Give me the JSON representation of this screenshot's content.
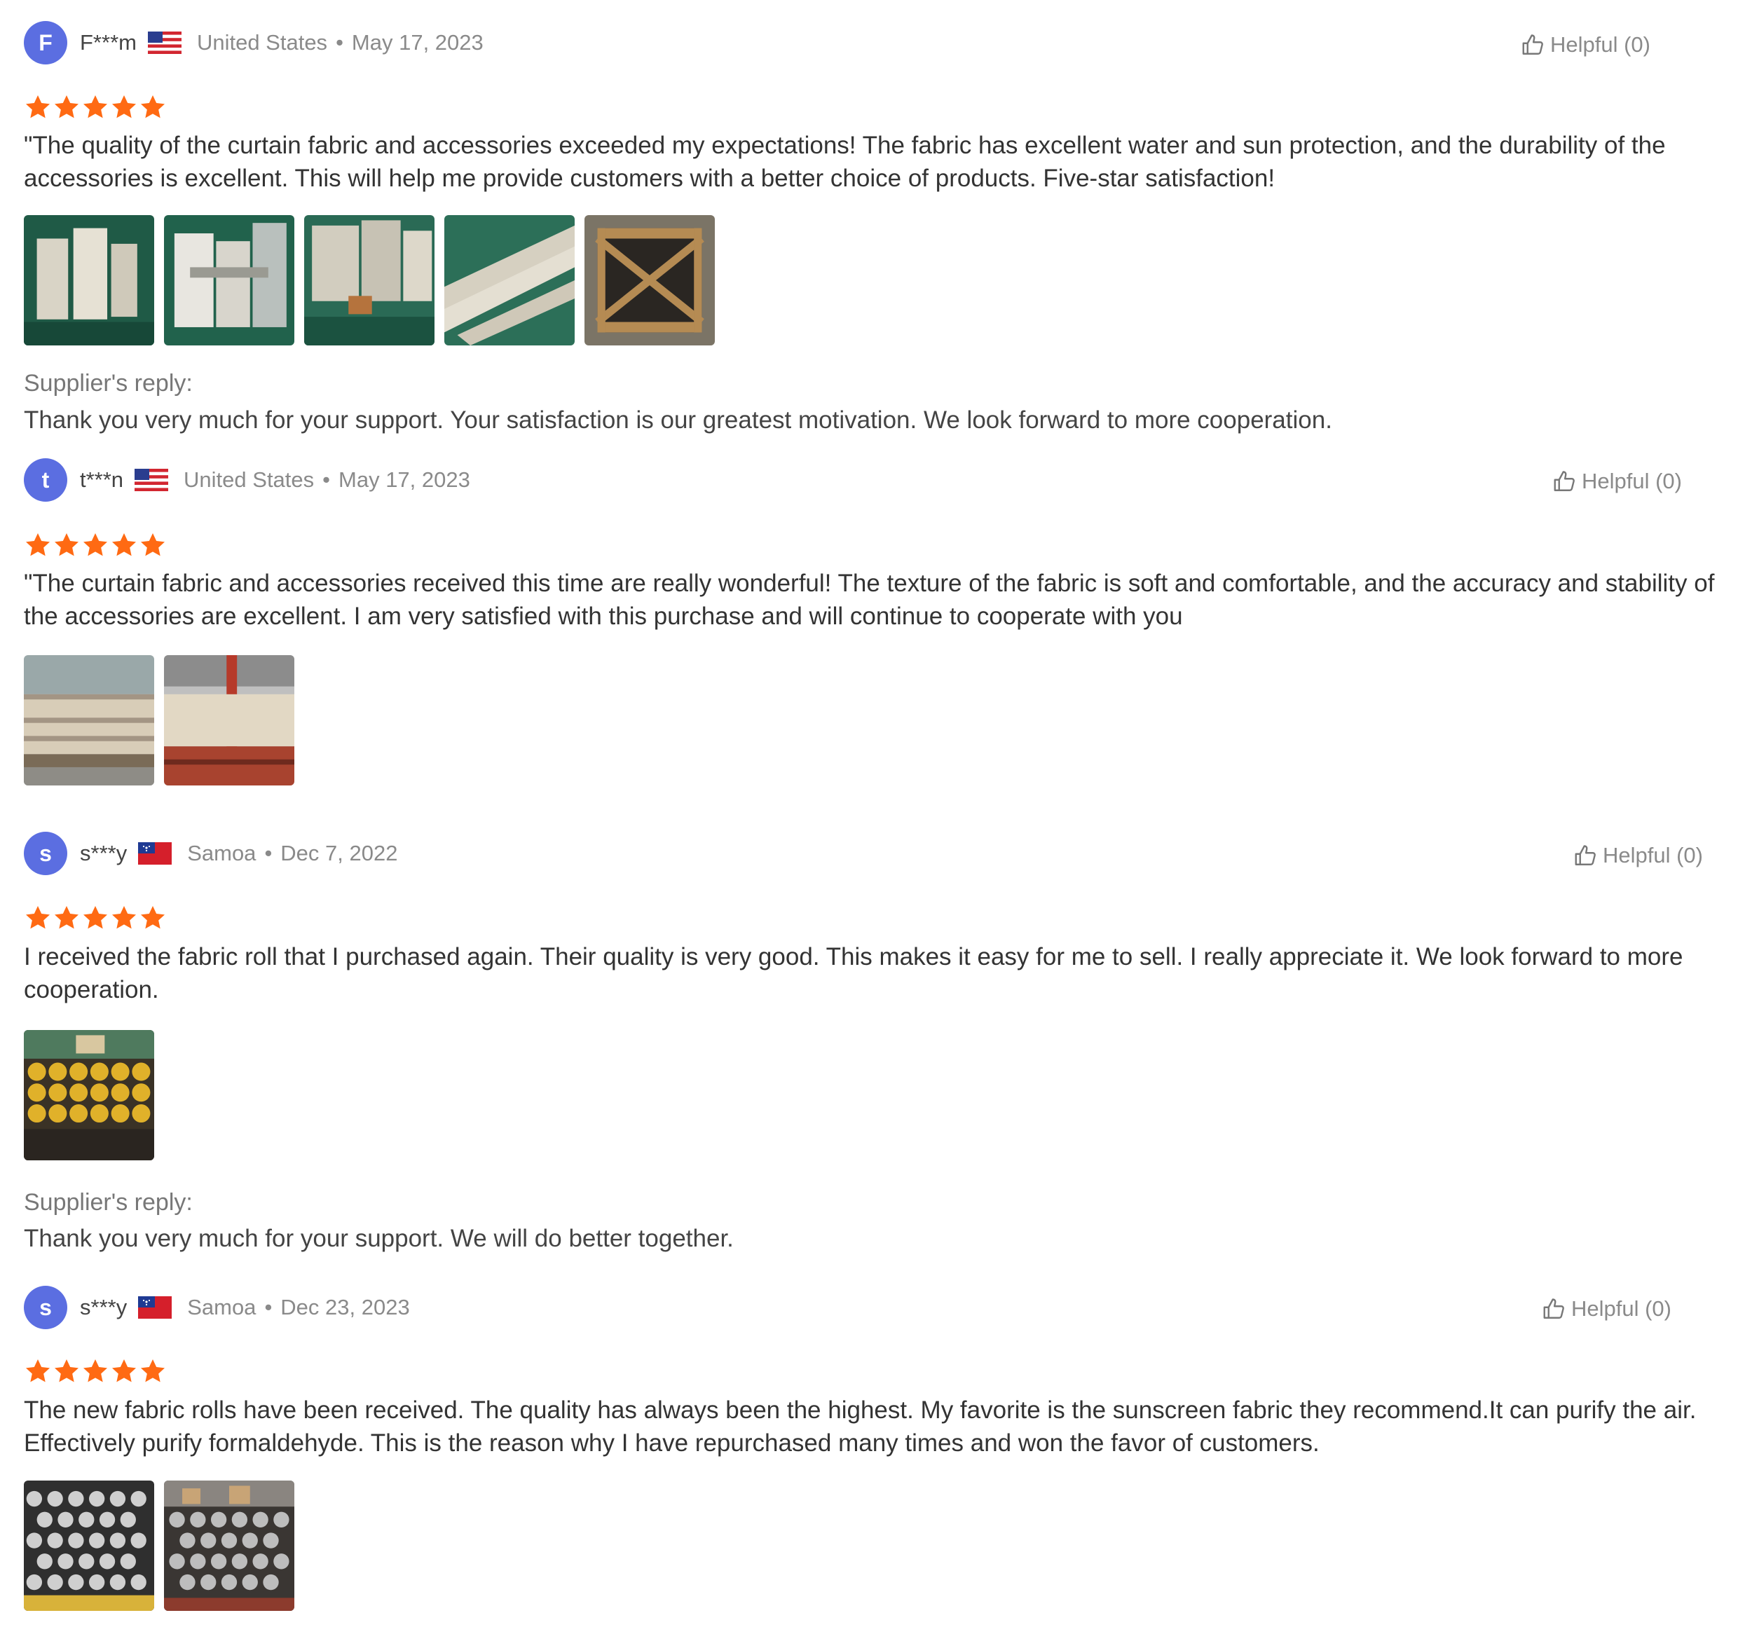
{
  "colors": {
    "star": "#ff6a13",
    "avatar": "#5b6ee1",
    "muted": "#8a8a8a"
  },
  "reviews": [
    {
      "avatar_letter": "F",
      "username": "F***m",
      "flag_icon": "us-flag-icon",
      "country": "United States",
      "separator": "•",
      "date": "May 17, 2023",
      "helpful_label": "Helpful (0)",
      "rating": 5,
      "text": "\"The quality of the curtain fabric and accessories exceeded my expectations! The fabric has excellent water and sun protection, and the durability of the accessories is excellent. This will help me provide customers with a better choice of products. Five-star satisfaction!",
      "supplier_reply_label": "Supplier's reply:",
      "supplier_reply": "Thank you very much for your support. Your satisfaction is our greatest motivation. We look forward to more cooperation."
    },
    {
      "avatar_letter": "t",
      "username": "t***n",
      "flag_icon": "us-flag-icon",
      "country": "United States",
      "separator": "•",
      "date": "May 17, 2023",
      "helpful_label": "Helpful (0)",
      "rating": 5,
      "text": "\"The curtain fabric and accessories received this time are really wonderful! The texture of the fabric is soft and comfortable, and the accuracy and stability of the accessories are excellent. I am very satisfied with this purchase and will continue to cooperate with you"
    },
    {
      "avatar_letter": "s",
      "username": "s***y",
      "flag_icon": "samoa-flag-icon",
      "country": "Samoa",
      "separator": "•",
      "date": "Dec 7, 2022",
      "helpful_label": "Helpful (0)",
      "rating": 5,
      "text": "I received the fabric roll that I purchased again. Their quality is very good. This makes it easy for me to sell. I really appreciate it.   We look forward to more cooperation.",
      "supplier_reply_label": "Supplier's reply:",
      "supplier_reply": "Thank you very much for your support. We will do better together."
    },
    {
      "avatar_letter": "s",
      "username": "s***y",
      "flag_icon": "samoa-flag-icon",
      "country": "Samoa",
      "separator": "•",
      "date": "Dec 23, 2023",
      "helpful_label": "Helpful (0)",
      "rating": 5,
      "text": "The new fabric rolls have been received. The quality has always been the highest. My favorite is the sunscreen fabric they recommend.It can purify the air. Effectively purify formaldehyde. This is the reason why I have repurchased many times and won the favor of customers."
    }
  ]
}
